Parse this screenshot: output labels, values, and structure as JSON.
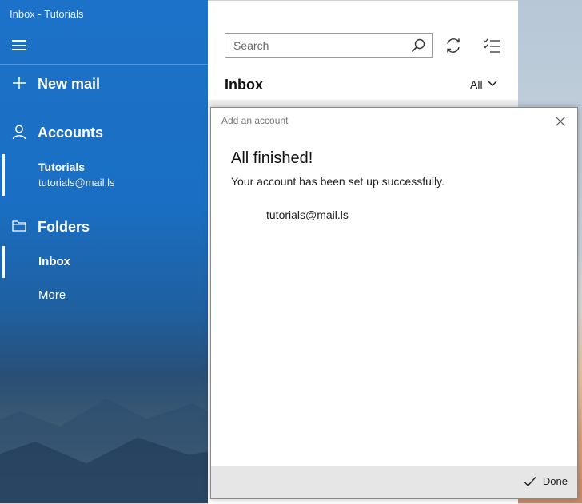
{
  "window": {
    "title": "Inbox - Tutorials"
  },
  "nav": {
    "new_mail": "New mail",
    "accounts": "Accounts",
    "account": {
      "name": "Tutorials",
      "email": "tutorials@mail.ls"
    },
    "folders": "Folders",
    "folder_items": [
      {
        "label": "Inbox",
        "selected": true
      },
      {
        "label": "More",
        "selected": false
      }
    ]
  },
  "list": {
    "search_placeholder": "Search",
    "title": "Inbox",
    "filter": "All"
  },
  "dialog": {
    "title": "Add an account",
    "heading": "All finished!",
    "message": "Your account has been set up successfully.",
    "account_email": "tutorials@mail.ls",
    "done_label": "Done"
  },
  "colors": {
    "nav_blue": "#1c72c8",
    "footer_gray": "#e6e6e6"
  },
  "icons": [
    "hamburger-icon",
    "plus-icon",
    "person-icon",
    "folder-icon",
    "search-icon",
    "sync-icon",
    "select-mode-icon",
    "chevron-down-icon",
    "close-icon",
    "checkmark-icon"
  ]
}
